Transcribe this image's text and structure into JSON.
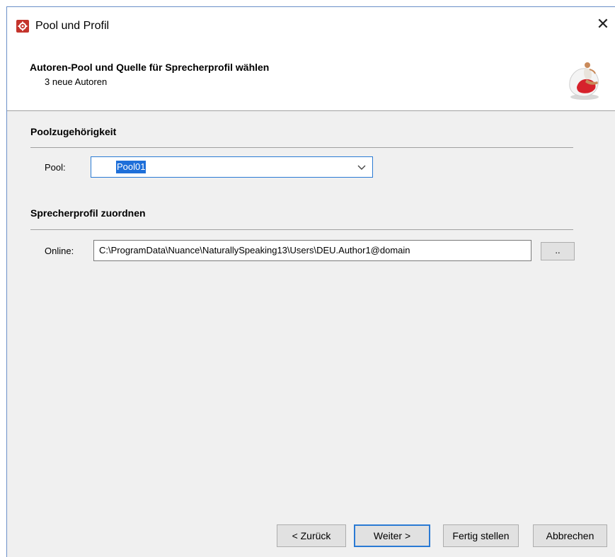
{
  "window": {
    "title": "Pool und Profil",
    "close_glyph": "✕"
  },
  "header": {
    "title": "Autoren-Pool und Quelle für Sprecherprofil wählen",
    "subtitle": "3 neue Autoren",
    "art_icon": "person-sitting-in-egg-chair-icon"
  },
  "pool_section": {
    "title": "Poolzugehörigkeit",
    "pool_label": "Pool:",
    "pool_value": "Pool01"
  },
  "profile_section": {
    "title": "Sprecherprofil zuordnen",
    "online_label": "Online:",
    "online_path": "C:\\ProgramData\\Nuance\\NaturallySpeaking13\\Users\\DEU.Author1@domain",
    "browse_label": ".."
  },
  "buttons": {
    "back": "< Zurück",
    "next": "Weiter >",
    "finish": "Fertig stellen",
    "cancel": "Abbrechen"
  },
  "colors": {
    "accent": "#2a7ad4",
    "selection": "#1e6fd9",
    "app_icon": "#c4342c"
  }
}
